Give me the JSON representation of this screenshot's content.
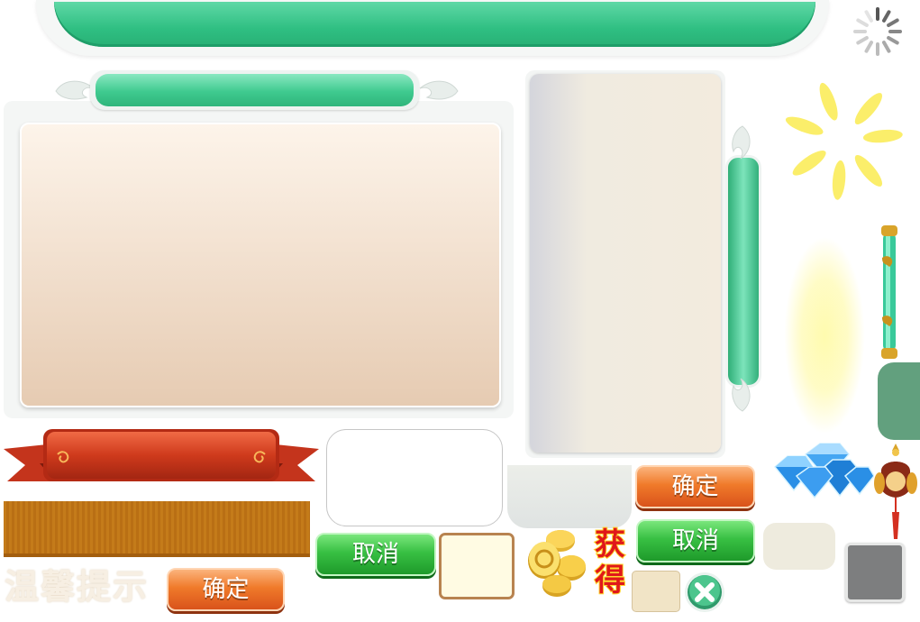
{
  "texts": {
    "tip_title": "温馨提示",
    "confirm": "确定",
    "cancel": "取消",
    "obtain": "获得"
  },
  "icons": {
    "spinner": "loading-spinner-icon",
    "sunburst": "sunburst-effect",
    "close": "close-icon",
    "coins": "gold-coins-icon",
    "diamonds": "diamonds-icon",
    "mascot": "lucky-bag-mascot"
  },
  "colors": {
    "banner_green": "#2fbf82",
    "button_orange": "#f07a2a",
    "button_green": "#38c043",
    "ribbon_red": "#c8341e",
    "obtain_red": "#e0181a",
    "side_tab_green": "#62a07e"
  }
}
